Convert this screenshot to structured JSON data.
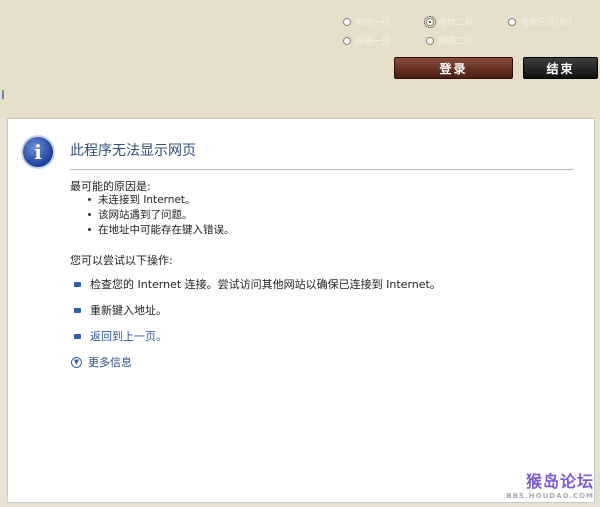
{
  "servers": [
    {
      "label": "电信一区",
      "selected": false
    },
    {
      "label": "电信二区",
      "selected": true
    },
    {
      "label": "电信三区(新)",
      "selected": false
    },
    {
      "label": "网通一区",
      "selected": false
    },
    {
      "label": "网通二区",
      "selected": false
    }
  ],
  "buttons": {
    "login": "登录",
    "exit": "结束"
  },
  "error": {
    "title": "此程序无法显示网页",
    "causes_heading": "最可能的原因是:",
    "causes": [
      "未连接到 Internet。",
      "该网站遇到了问题。",
      "在地址中可能存在键入错误。"
    ],
    "actions_heading": "您可以尝试以下操作:",
    "actions": [
      {
        "text": "检查您的 Internet 连接。尝试访问其他网站以确保已连接到 Internet。",
        "link": false
      },
      {
        "text": "重新键入地址。",
        "link": false
      },
      {
        "text": "返回到上一页。",
        "link": true
      }
    ],
    "more_info": "更多信息"
  },
  "watermark": {
    "main": "猴岛论坛",
    "sub": "BBS.HOUDAO.COM"
  },
  "colors": {
    "login": "#5a2a1e",
    "exit": "#1a1a1a",
    "title": "#2e4f7c",
    "link": "#2e5a9a"
  }
}
